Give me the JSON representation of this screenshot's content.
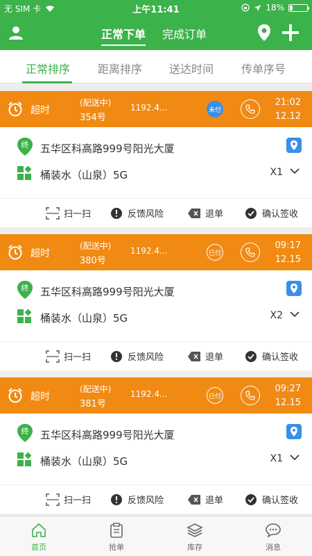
{
  "status_bar": {
    "carrier": "无 SIM 卡",
    "time": "上午11:41",
    "battery": "18%",
    "battery_level": 0.18
  },
  "nav": {
    "tab_active": "正常下单",
    "tab_other": "完成订单"
  },
  "sort_tabs": [
    "正常排序",
    "距离排序",
    "送达时间",
    "传单序号"
  ],
  "actions": {
    "scan": "扫一扫",
    "feedback": "反馈风险",
    "refund": "退单",
    "confirm": "确认签收"
  },
  "orders": [
    {
      "overtime": "超时",
      "status": "(配送中)",
      "number": "354号",
      "distance": "1192.4...",
      "pay": "未付",
      "time": "21:02",
      "date": "12.12",
      "address": "五华区科高路999号阳光大厦",
      "product": "桶装水（山泉）5G",
      "qty": "X1"
    },
    {
      "overtime": "超时",
      "status": "(配送中)",
      "number": "380号",
      "distance": "1192.4...",
      "pay": "已付",
      "time": "09:17",
      "date": "12.15",
      "address": "五华区科高路999号阳光大厦",
      "product": "桶装水（山泉）5G",
      "qty": "X2"
    },
    {
      "overtime": "超时",
      "status": "(配送中)",
      "number": "381号",
      "distance": "1192.4...",
      "pay": "已付",
      "time": "09:27",
      "date": "12.15",
      "address": "五华区科高路999号阳光大厦",
      "product": "桶装水（山泉）5G",
      "qty": "X1"
    }
  ],
  "tabbar": [
    "首页",
    "抢单",
    "库存",
    "消息"
  ],
  "colors": {
    "green": "#3cb24a",
    "orange": "#f08a13",
    "blue": "#3a8fe6"
  }
}
